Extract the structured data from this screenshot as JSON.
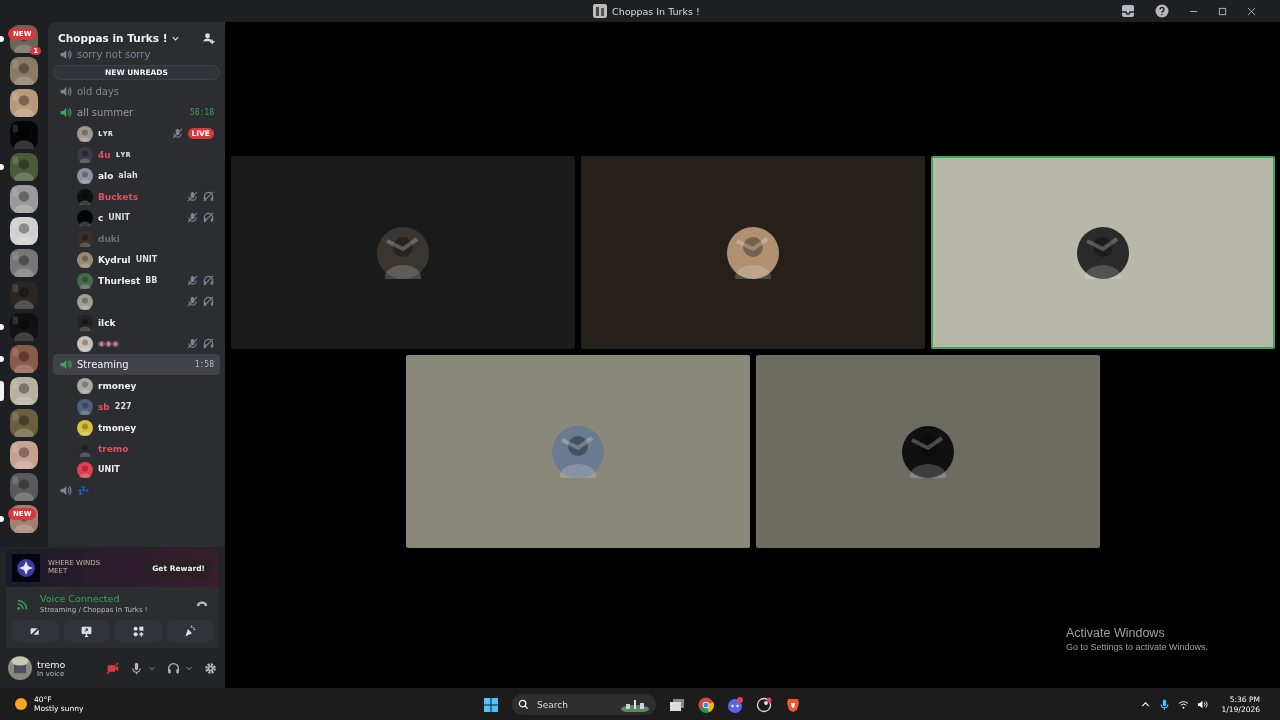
{
  "window": {
    "title": "Choppas In Turks !"
  },
  "servers": [
    {
      "badge": "NEW",
      "count": "1",
      "unread": true,
      "selected": false
    },
    {
      "unread": false,
      "selected": false
    },
    {
      "unread": false,
      "selected": false
    },
    {
      "unread": false,
      "selected": false
    },
    {
      "unread": true,
      "selected": false
    },
    {
      "unread": false,
      "selected": false
    },
    {
      "unread": false,
      "selected": false
    },
    {
      "unread": false,
      "selected": false
    },
    {
      "unread": false,
      "selected": false
    },
    {
      "unread": true,
      "selected": false
    },
    {
      "unread": true,
      "selected": false
    },
    {
      "unread": false,
      "selected": true
    },
    {
      "unread": false,
      "selected": false
    },
    {
      "unread": false,
      "selected": false
    },
    {
      "unread": false,
      "selected": false
    },
    {
      "badge": "NEW",
      "unread": true,
      "selected": false
    }
  ],
  "server": {
    "name": "Choppas in Turks !",
    "unreads_pill": "NEW UNREADS"
  },
  "channels": [
    {
      "name": "sorry not sorry",
      "kind": "voice",
      "active": false
    },
    {
      "name": "old days",
      "kind": "voice",
      "active": false
    },
    {
      "name": "all summer",
      "kind": "voice",
      "active": true,
      "selected": false,
      "timer": "58:18",
      "members": [
        {
          "tag": "ʟʏʀ",
          "color": "#dbdee1",
          "muted": true,
          "deafened": false,
          "live": "LIVE"
        },
        {
          "name": "4u",
          "tag": "ʟʏʀ",
          "color": "#e0505f",
          "muted": false,
          "deafened": false
        },
        {
          "name": "alo",
          "tag": "alah",
          "color": "#f2f3f5",
          "muted": false,
          "deafened": false
        },
        {
          "name": "Buckets",
          "color": "#e0505f",
          "muted": true,
          "deafened": true
        },
        {
          "name": "c",
          "tag": "UNIT",
          "color": "#f2f3f5",
          "muted": true,
          "deafened": true
        },
        {
          "name": "duki",
          "color": "#6d6f78",
          "muted": false,
          "deafened": false
        },
        {
          "name": "Kydrul",
          "tag": "UNIT",
          "color": "#f2f3f5",
          "muted": false,
          "deafened": false
        },
        {
          "name": "Thurlest",
          "tag": "BB",
          "color": "#f2f3f5",
          "muted": true,
          "deafened": true
        },
        {
          "muted": true,
          "deafened": true
        },
        {
          "name": "ilck",
          "color": "#f2f3f5",
          "muted": false,
          "deafened": false
        },
        {
          "tag": "◉◉◉",
          "color": "#d87a9a",
          "muted": true,
          "deafened": true
        }
      ]
    },
    {
      "name": "Streaming",
      "kind": "voice",
      "active": true,
      "selected": true,
      "timer": "1:58",
      "members": [
        {
          "name": "rmoney",
          "color": "#f2f3f5",
          "muted": false,
          "deafened": false
        },
        {
          "name": "sb",
          "tag": "227",
          "color": "#e0505f",
          "muted": false,
          "deafened": false
        },
        {
          "name": "tmoney",
          "color": "#f2f3f5",
          "muted": false,
          "deafened": false
        },
        {
          "name": "tremo",
          "color": "#e0505f",
          "muted": false,
          "deafened": false
        },
        {
          "tag": "UNIT",
          "color": "#f2f3f5",
          "muted": false,
          "deafened": false
        }
      ]
    },
    {
      "name": "💤",
      "kind": "voice",
      "active": false
    }
  ],
  "promo": {
    "logo_text": "WHERE WINDS MEET",
    "button": "Get Reward!"
  },
  "voice": {
    "status": "Voice Connected",
    "location": "Streaming / Choppas In Turks !"
  },
  "user": {
    "name": "tremo",
    "status": "In voice",
    "camera_off": true
  },
  "tiles": [
    {
      "color": "#1a1a1a",
      "speaking": false
    },
    {
      "color": "#25211a",
      "speaking": false
    },
    {
      "color": "#b8b8a8",
      "speaking": true
    },
    {
      "color": "#8a8878",
      "speaking": false
    },
    {
      "color": "#6e6c62",
      "speaking": false
    }
  ],
  "activation": {
    "title": "Activate Windows",
    "subtitle": "Go to Settings to activate Windows."
  },
  "taskbar": {
    "temperature": "40°F",
    "weather": "Mostly sunny",
    "search": "Search",
    "time": "5:36 PM",
    "date": "1/19/2026"
  }
}
